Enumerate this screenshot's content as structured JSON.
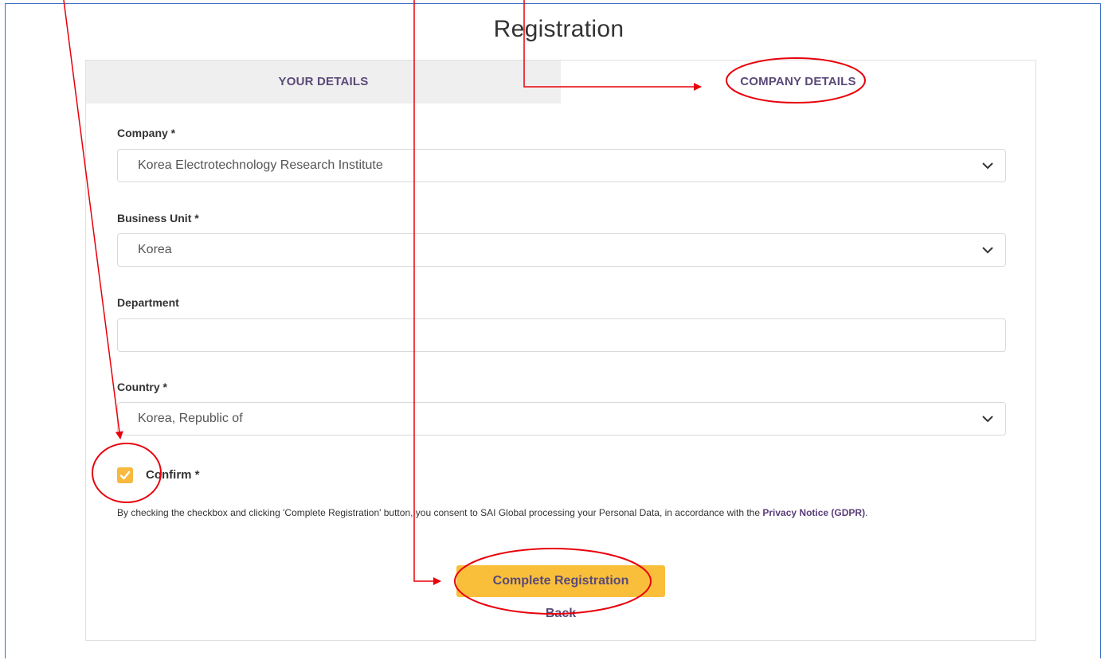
{
  "page": {
    "title": "Registration"
  },
  "tabs": [
    {
      "label": "YOUR DETAILS",
      "active": false
    },
    {
      "label": "COMPANY DETAILS",
      "active": true
    }
  ],
  "form": {
    "company": {
      "label": "Company *",
      "value": "Korea Electrotechnology Research Institute"
    },
    "business_unit": {
      "label": "Business Unit *",
      "value": "Korea"
    },
    "department": {
      "label": "Department",
      "value": ""
    },
    "country": {
      "label": "Country *",
      "value": "Korea, Republic of"
    },
    "confirm": {
      "label": "Confirm *",
      "checked": true
    },
    "consent_text": "By checking the checkbox and clicking 'Complete Registration' button, you consent to SAI Global processing your Personal Data, in accordance with the",
    "consent_link": "Privacy Notice (GDPR)",
    "consent_end": "."
  },
  "actions": {
    "complete_label": "Complete Registration",
    "back_label": "Back"
  },
  "colors": {
    "accent": "#f9bf3b",
    "tab_text": "#5a4a78",
    "annotation": "#e8000b",
    "frame_border": "#3a6fc4"
  },
  "icons": {
    "select_chevron": "chevron-down-icon",
    "checkbox": "checkmark-icon"
  }
}
